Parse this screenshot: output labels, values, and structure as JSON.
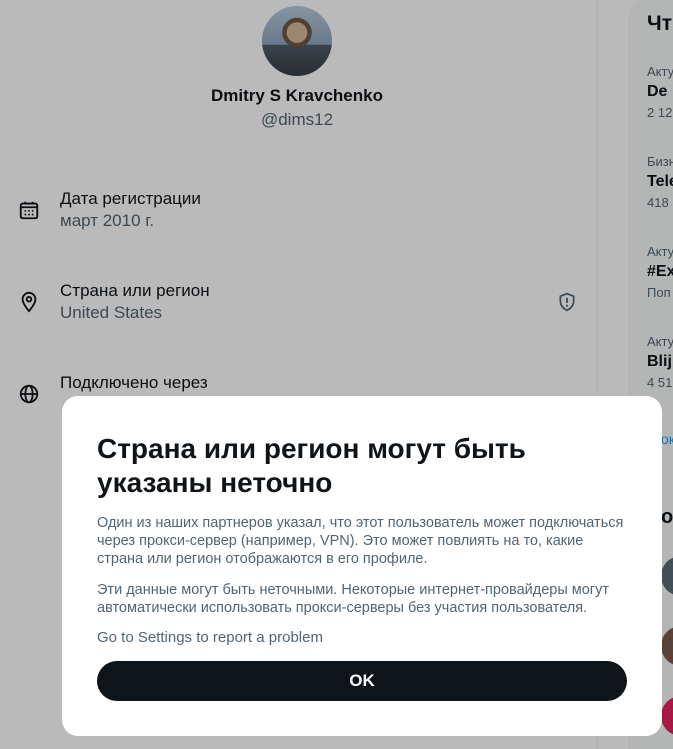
{
  "profile": {
    "name": "Dmitry S Kravchenko",
    "handle": "@dims12"
  },
  "about": {
    "join": {
      "label": "Дата регистрации",
      "value": "март 2010 г.",
      "icon": "calendar-icon"
    },
    "country": {
      "label": "Страна или регион",
      "value": "United States",
      "icon": "location-pin-icon",
      "badge_icon": "shield-alert-icon"
    },
    "connected": {
      "label": "Подключено через",
      "value": "",
      "icon": "globe-icon"
    }
  },
  "sidebar": {
    "heading": "Чт",
    "trends": [
      {
        "category": "Акту",
        "title": "De",
        "count": "2 12"
      },
      {
        "category": "Бизн",
        "title": "Tele",
        "count": "418"
      },
      {
        "category": "Акту",
        "title": "#Ex",
        "count": "Поп"
      },
      {
        "category": "Акту",
        "title": "Blij",
        "count": "4 51"
      }
    ],
    "show_more": "ок",
    "who_heading": "о"
  },
  "dialog": {
    "title": "Страна или регион могут быть указаны неточно",
    "paragraph1": "Один из наших партнеров указал, что этот пользователь может подключаться через прокси-сервер (например, VPN). Это может повлиять на то, какие страна или регион отображаются в его профиле.",
    "paragraph2": "Эти данные могут быть неточными. Некоторые интернет-провайдеры могут автоматически использовать прокси-серверы без участия пользователя.",
    "settings_link": "Go to Settings to report a problem",
    "ok_label": "OK"
  },
  "colors": {
    "text_primary": "#0f1419",
    "text_secondary": "#536471",
    "accent": "#1d9bf0",
    "button_bg": "#0f1419"
  }
}
